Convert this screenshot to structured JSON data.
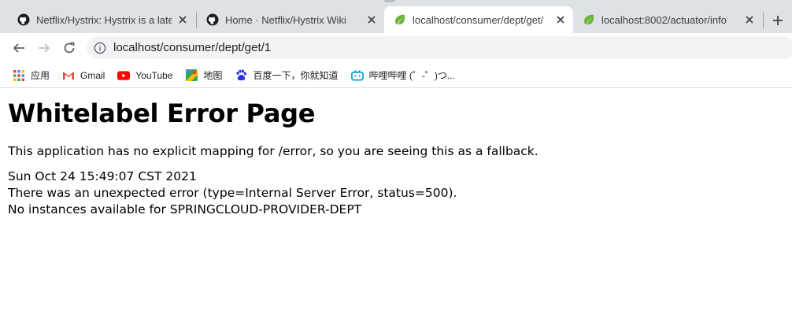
{
  "browser": {
    "tabs": [
      {
        "title": "Netflix/Hystrix: Hystrix is a late",
        "favicon": "github-icon",
        "active": false
      },
      {
        "title": "Home · Netflix/Hystrix Wiki",
        "favicon": "github-icon",
        "active": false
      },
      {
        "title": "localhost/consumer/dept/get/",
        "favicon": "spring-leaf-icon",
        "active": true
      },
      {
        "title": "localhost:8002/actuator/info",
        "favicon": "spring-leaf-icon",
        "active": false
      }
    ],
    "address_bar": {
      "url": "localhost/consumer/dept/get/1"
    },
    "bookmarks": [
      {
        "label": "应用",
        "icon": "apps-grid-icon"
      },
      {
        "label": "Gmail",
        "icon": "gmail-icon"
      },
      {
        "label": "YouTube",
        "icon": "youtube-icon"
      },
      {
        "label": "地图",
        "icon": "maps-icon"
      },
      {
        "label": "百度一下，你就知道",
        "icon": "baidu-icon"
      },
      {
        "label": "哔哩哔哩 (゜-゜)つ...",
        "icon": "bilibili-icon"
      }
    ]
  },
  "page": {
    "title": "Whitelabel Error Page",
    "description": "This application has no explicit mapping for /error, so you are seeing this as a fallback.",
    "timestamp": "Sun Oct 24 15:49:07 CST 2021",
    "error_line": "There was an unexpected error (type=Internal Server Error, status=500).",
    "message": "No instances available for SPRINGCLOUD-PROVIDER-DEPT"
  },
  "colors": {
    "tab_strip": "#dee1e6",
    "spring_green": "#6db33f",
    "youtube_red": "#ff0000",
    "bilibili_blue": "#00a1d6",
    "baidu_blue": "#2932e1"
  }
}
